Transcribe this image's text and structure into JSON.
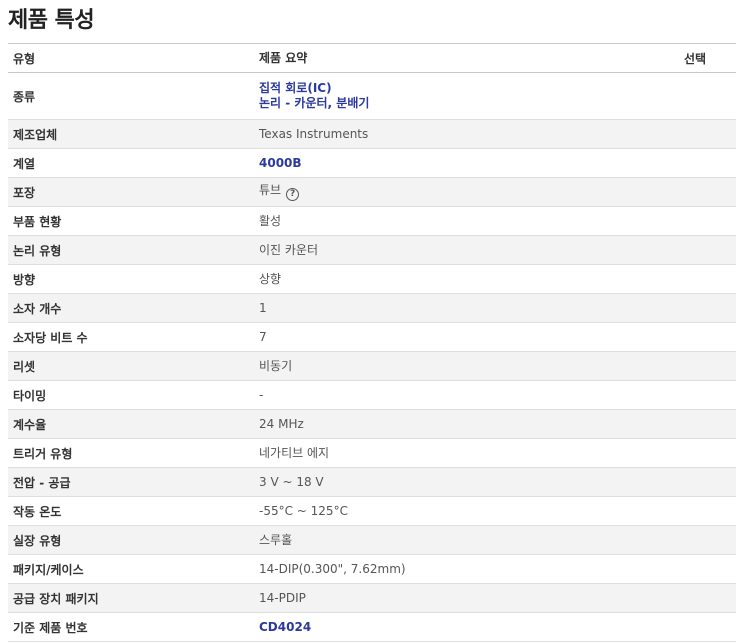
{
  "page_title": "제품 특성",
  "header": {
    "type": "유형",
    "summary": "제품 요약",
    "select": "선택"
  },
  "rows": [
    {
      "label": "종류",
      "value": "",
      "links": [
        "집적 회로(IC)",
        "논리 - 카운터, 분배기"
      ]
    },
    {
      "label": "제조업체",
      "value": "Texas Instruments"
    },
    {
      "label": "계열",
      "value": "4000B",
      "link": true
    },
    {
      "label": "포장",
      "value": "튜브",
      "help_icon": "question-circle-icon"
    },
    {
      "label": "부품 현황",
      "value": "활성"
    },
    {
      "label": "논리 유형",
      "value": "이진 카운터"
    },
    {
      "label": "방향",
      "value": "상향"
    },
    {
      "label": "소자 개수",
      "value": "1"
    },
    {
      "label": "소자당 비트 수",
      "value": "7"
    },
    {
      "label": "리셋",
      "value": "비동기"
    },
    {
      "label": "타이밍",
      "value": "-"
    },
    {
      "label": "계수율",
      "value": "24 MHz"
    },
    {
      "label": "트리거 유형",
      "value": "네가티브 에지"
    },
    {
      "label": "전압 - 공급",
      "value": "3 V ~ 18 V"
    },
    {
      "label": "작동 온도",
      "value": "-55°C ~ 125°C"
    },
    {
      "label": "실장 유형",
      "value": "스루홀"
    },
    {
      "label": "패키지/케이스",
      "value": "14-DIP(0.300\", 7.62mm)"
    },
    {
      "label": "공급 장치 패키지",
      "value": "14-PDIP"
    },
    {
      "label": "기준 제품 번호",
      "value": "CD4024",
      "link": true
    }
  ]
}
